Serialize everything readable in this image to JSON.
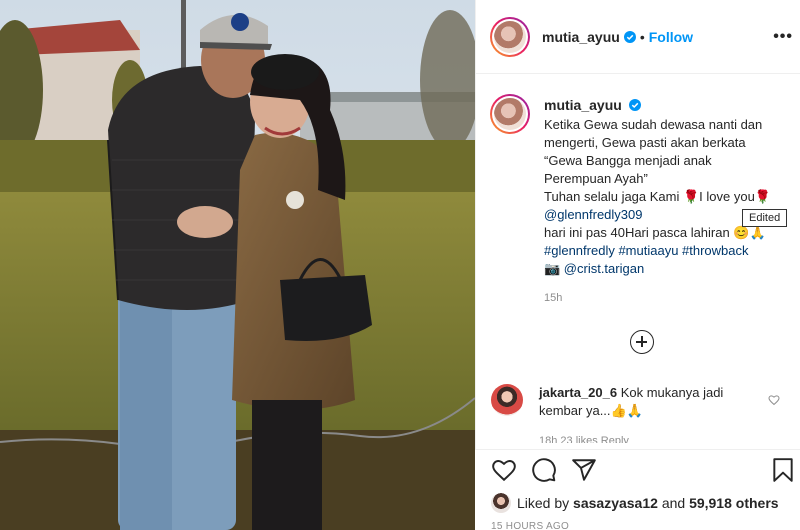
{
  "post": {
    "image_alt": "Couple photo in a park",
    "username": "mutia_ayuu",
    "follow_label": "Follow",
    "more_label": "•••",
    "caption": {
      "username": "mutia_ayuu",
      "lines": [
        "Ketika Gewa sudah dewasa nanti dan",
        "mengerti, Gewa pasti akan berkata",
        "“Gewa Bangga menjadi anak",
        "Perempuan Ayah”",
        "Tuhan selalu jaga Kami 🌹I love you🌹",
        "@glennfredly309",
        "hari ini pas 40Hari pasca lahiran 😊🙏",
        "#glennfredly #mutiaayu #throwback",
        "📷 @crist.tarigan"
      ],
      "time": "15h"
    },
    "tooltip": "Edited",
    "comment": {
      "username": "jakarta_20_6",
      "text": "Kok mukanya jadi kembar ya...👍🙏",
      "meta": "18h 23 likes Reply"
    },
    "likes": {
      "user": "sasazyasa12",
      "count": "59,918 others",
      "liked_by_label": "Liked by",
      "and_label": "and"
    },
    "timestamp": "15 HOURS AGO"
  },
  "icons": [
    "verified-badge-icon",
    "more-options-icon",
    "add-comments-icon",
    "heart-icon",
    "comment-icon",
    "share-icon",
    "bookmark-icon"
  ],
  "colors": {
    "link": "#00376b",
    "follow": "#0095f6",
    "verified": "#0095f6",
    "muted": "#8e8e8e"
  }
}
